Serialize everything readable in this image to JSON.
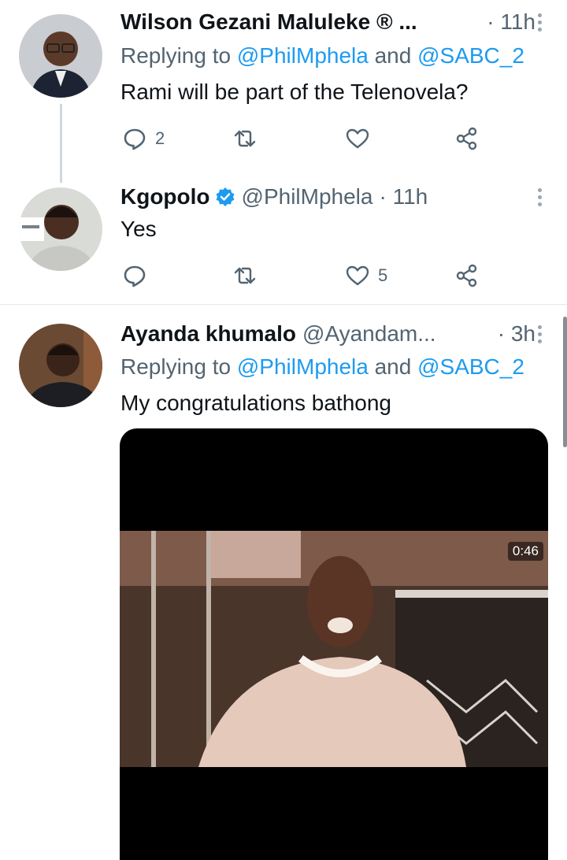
{
  "tweets": [
    {
      "name": "Wilson Gezani Maluleke ® ...",
      "handle": "",
      "time": "· 11h",
      "replying_prefix": "Replying to ",
      "mention_1": "@PhilMphela",
      "and": " and ",
      "mention_2": "@SABC_2",
      "text": "Rami will be part of the Telenovela?",
      "reply_count": "2",
      "retweet_count": "",
      "like_count": ""
    },
    {
      "name": "Kgopolo",
      "handle": "@PhilMphela",
      "time": "· 11h",
      "text": "Yes",
      "reply_count": "",
      "retweet_count": "",
      "like_count": "5",
      "verified": true
    },
    {
      "name": "Ayanda khumalo",
      "handle": "@Ayandam...",
      "time": "· 3h",
      "replying_prefix": "Replying to ",
      "mention_1": "@PhilMphela",
      "and": " and ",
      "mention_2": "@SABC_2",
      "text": "My congratulations bathong",
      "media": {
        "type": "video",
        "duration": "0:46"
      }
    }
  ],
  "colors": {
    "accent": "#1d9bf0",
    "secondary_text": "#536471",
    "verified": "#1d9bf0"
  },
  "icons": [
    "reply-icon",
    "retweet-icon",
    "like-icon",
    "share-icon",
    "more-icon",
    "verified-badge-icon"
  ]
}
